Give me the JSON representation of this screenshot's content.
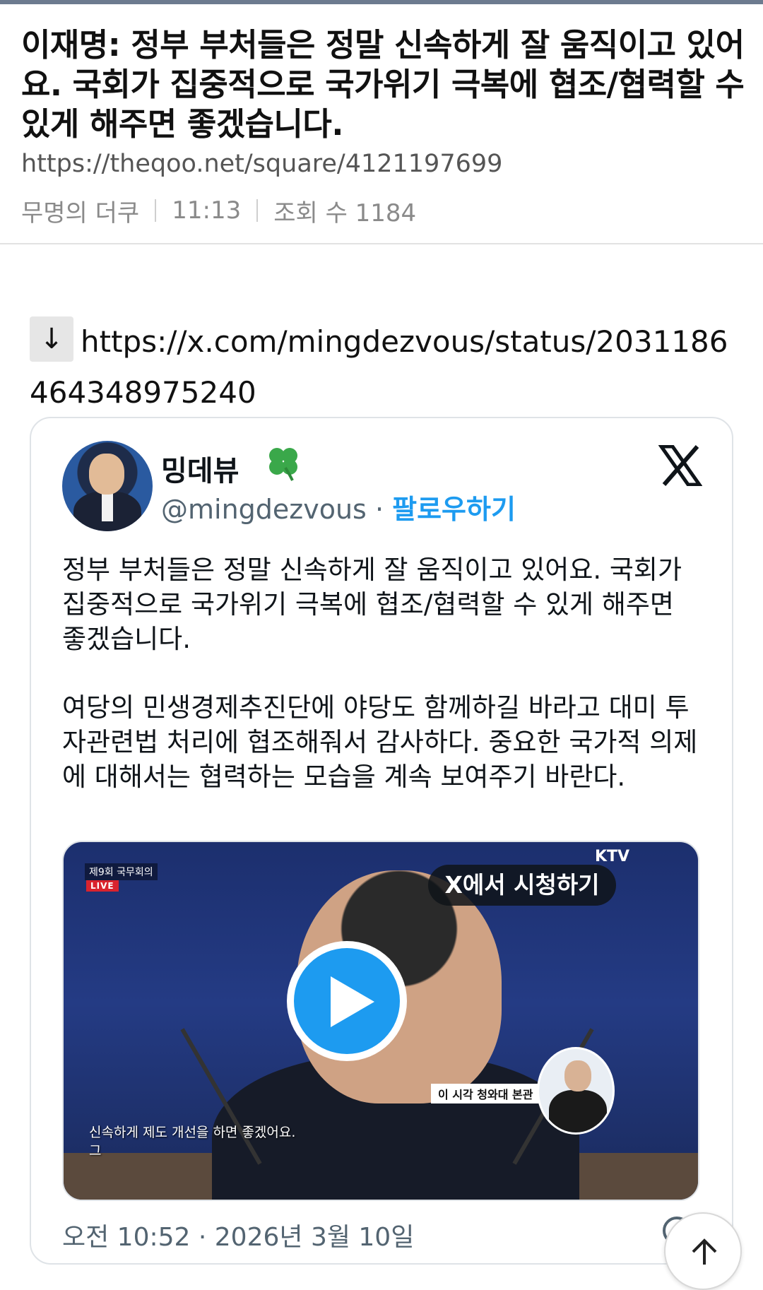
{
  "post": {
    "title": "이재명: 정부 부처들은 정말 신속하게 잘 움직이고 있어요. 국회가 집중적으로 국가위기 극복에 협조/협력할 수 있게 해주면 좋겠습니다.",
    "url": "https://theqoo.net/square/4121197699",
    "author": "무명의 더쿠",
    "time": "11:13",
    "views": "조회 수 1184"
  },
  "link": {
    "arrow": "↓",
    "url": "https://x.com/mingdezvous/status/2031186464348975240"
  },
  "tweet": {
    "display_name": "밍데뷰",
    "handle": "@mingdezvous",
    "separator": "·",
    "follow_label": "팔로우하기",
    "paragraphs": [
      "정부 부처들은 정말 신속하게 잘 움직이고 있어요. 국회가 집중적으로 국가위기 극복에 협조/협력할 수 있게 해주면 좋겠습니다.",
      "여당의 민생경제추진단에 야당도 함께하길 바라고 대미 투자관련법 처리에 협조해줘서 감사하다. 중요한 국가적 의제에 대해서는 협력하는 모습을 계속 보여주기 바란다."
    ],
    "timestamp": "오전 10:52 · 2026년 3월 10일"
  },
  "video": {
    "broadcast_label": "제9회 국무회의",
    "live_label": "LIVE",
    "channel": "KTV",
    "watch_label": "X에서 시청하기",
    "caption_line1": "신속하게 제도 개선을 하면 좋겠어요.",
    "caption_line2": "그",
    "location": "이 시각 청와대 본관"
  },
  "colors": {
    "accent": "#1d9bf0",
    "muted": "#536471",
    "topbar": "#6d7b8f"
  },
  "icons": [
    "clover-icon",
    "x-logo-icon",
    "play-icon",
    "arrow-up-icon"
  ]
}
